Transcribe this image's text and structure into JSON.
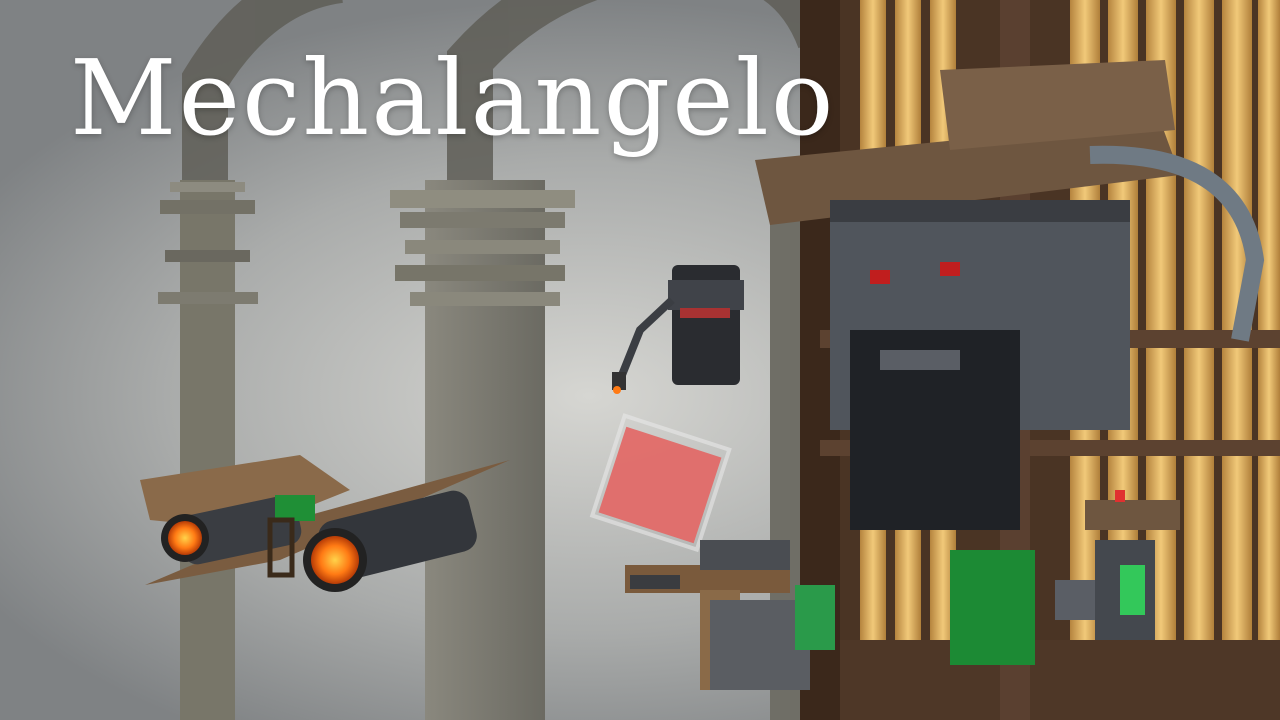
{
  "game": {
    "title": "Mechalangelo"
  },
  "icons": {
    "jet_wings": "winged-jetpack-icon",
    "drone": "flying-robot-drone-icon",
    "paint_gun": "paint-spray-gun-icon",
    "robot_head": "robot-head-with-hat-icon",
    "small_bot": "small-green-robot-icon",
    "organ": "pipe-organ-icon"
  },
  "colors": {
    "sky": "#b9bbba",
    "pillar": "#6f6d64",
    "title_text": "#ffffff",
    "wood": "#5a3f2c",
    "organ_pipe": "#d8aa55",
    "robot_metal": "#3e4247",
    "paint": "#e26a68",
    "thruster_glow": "#ff8a1d",
    "green_light": "#33c85a"
  }
}
